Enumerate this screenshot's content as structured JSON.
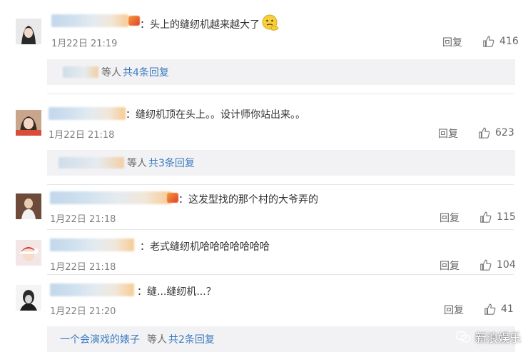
{
  "comments": [
    {
      "text": "：头上的缝纫机越来越大了",
      "emoji": "thinking-face-emoji",
      "time": "1月22日 21:19",
      "reply_label": "回复",
      "likes": "416",
      "more": {
        "prefix_name": "",
        "etc": "等人",
        "count": "共4条回复"
      }
    },
    {
      "text": "：缝纫机顶在头上。。设计师你站出来。。",
      "time": "1月22日 21:18",
      "reply_label": "回复",
      "likes": "623",
      "more": {
        "prefix_name": "",
        "etc": "等人",
        "count": "共3条回复"
      }
    },
    {
      "text": "：这发型找的那个村的大爷弄的",
      "time": "1月22日 21:18",
      "reply_label": "回复",
      "likes": "115"
    },
    {
      "text": "：老式缝纫机哈哈哈哈哈哈哈",
      "time": "1月22日 21:18",
      "reply_label": "回复",
      "likes": "104"
    },
    {
      "text": "：缝...缝纫机...？",
      "time": "1月22日 21:20",
      "reply_label": "回复",
      "likes": "41",
      "more": {
        "prefix_name": "一个会演戏的婊子",
        "etc": "等人",
        "count": "共2条回复"
      }
    }
  ],
  "watermark": {
    "text": "新浪娱乐"
  },
  "colors": {
    "link": "#3b7bbf",
    "muted": "#808080",
    "more_bg": "#f2f2f5"
  }
}
